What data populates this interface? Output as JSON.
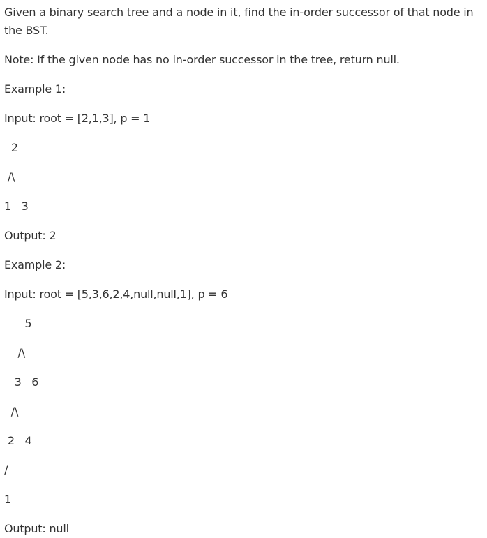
{
  "problem": {
    "statement": "Given a binary search tree and a node in it, find the in-order successor of that node in the BST.",
    "note": "Note: If the given node has no in-order successor in the tree, return null."
  },
  "example1": {
    "heading": "Example 1:",
    "input": "Input: root = [2,1,3], p = 1",
    "tree": [
      "  2",
      " /\\",
      "1   3"
    ],
    "output": "Output: 2"
  },
  "example2": {
    "heading": "Example 2:",
    "input": "Input: root = [5,3,6,2,4,null,null,1], p = 6",
    "tree": [
      "      5",
      "    /\\",
      "   3   6",
      "  /\\",
      " 2   4",
      "/",
      "1"
    ],
    "output": "Output: null"
  }
}
